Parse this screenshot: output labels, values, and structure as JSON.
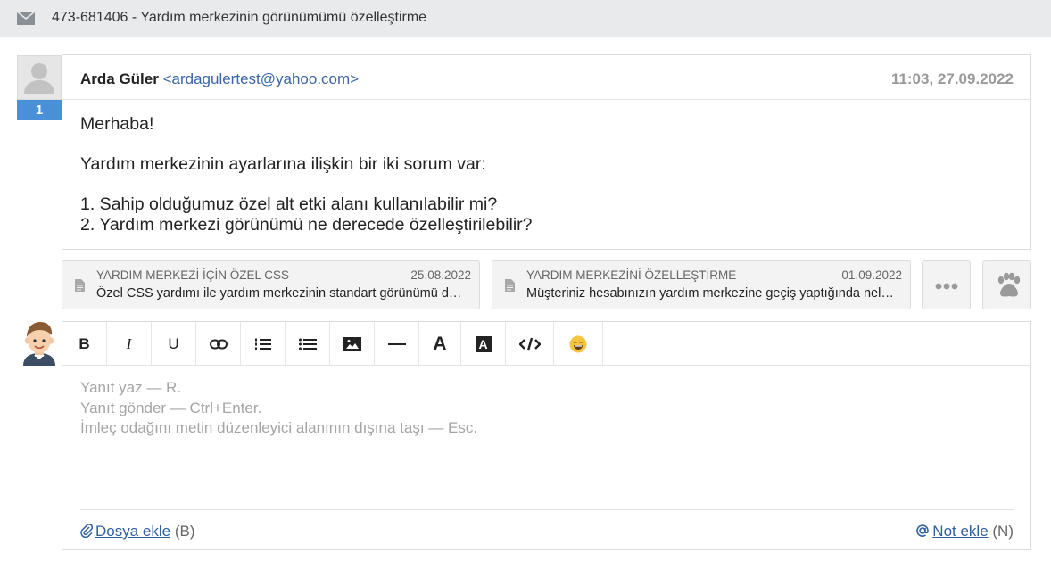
{
  "header": {
    "title": "473-681406 - Yardım merkezinin görünümümü özelleştirme"
  },
  "message": {
    "number": "1",
    "sender_name": "Arda Güler",
    "sender_email": "<ardagulertest@yahoo.com>",
    "date": "11:03, 27.09.2022",
    "body": {
      "greeting": "Merhaba!",
      "intro": "Yardım merkezinin ayarlarına ilişkin bir iki sorum var:",
      "q1": "1. Sahip olduğumuz özel alt etki alanı kullanılabilir mi?",
      "q2": "2. Yardım merkezi görünümü ne derecede özelleştirilebilir?"
    }
  },
  "suggestions": [
    {
      "title": "YARDIM MERKEZİ İÇİN ÖZEL CSS",
      "date": "25.08.2022",
      "text": "Özel CSS yardımı ile yardım merkezinin standart görünümü değiştirilebilir."
    },
    {
      "title": "YARDIM MERKEZİNİ ÖZELLEŞTİRME",
      "date": "01.09.2022",
      "text": "Müşteriniz hesabınızın yardım merkezine geçiş yaptığında neler görecek?"
    }
  ],
  "toolbar": {
    "bold": "B",
    "italic": "I",
    "underline": "U",
    "font_size": "A",
    "font_bg": "A"
  },
  "editor": {
    "hint1": "Yanıt yaz — R.",
    "hint2": "Yanıt gönder — Ctrl+Enter.",
    "hint3": "İmleç odağını metin düzenleyici alanının dışına taşı — Esc."
  },
  "footer": {
    "attach_label": "Dosya ekle",
    "attach_hotkey": " (B)",
    "note_label": "Not ekle",
    "note_hotkey": " (N)"
  },
  "colors": {
    "accent": "#4a90d9",
    "link": "#3a66a8",
    "header_bg": "#e9eaeb"
  },
  "icons": [
    "envelope-icon",
    "user-placeholder-icon",
    "document-icon",
    "more-icon",
    "paw-icon",
    "agent-avatar",
    "link-icon",
    "ordered-list-icon",
    "bullet-list-icon",
    "image-icon",
    "horizontal-rule-icon",
    "code-icon",
    "emoji-icon",
    "paperclip-icon",
    "at-icon"
  ]
}
